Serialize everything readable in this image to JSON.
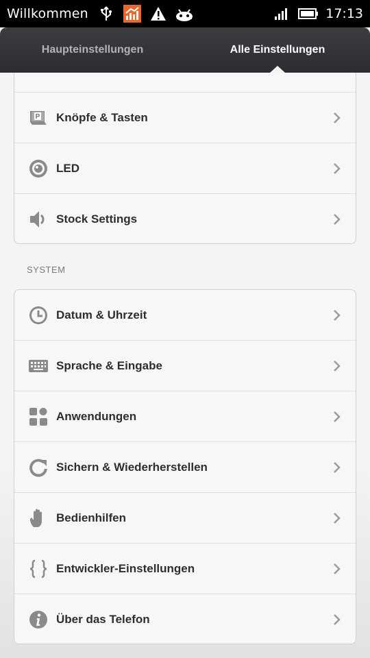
{
  "status_bar": {
    "title": "Willkommen",
    "time": "17:13",
    "icons_left": [
      "usb-icon",
      "chart-notification-icon",
      "warning-icon",
      "android-icon"
    ],
    "icons_right": [
      "signal-icon",
      "battery-icon"
    ],
    "accent_color": "#e8672a"
  },
  "tabs": [
    {
      "label": "Haupteinstellungen",
      "active": false
    },
    {
      "label": "Alle Einstellungen",
      "active": true
    }
  ],
  "group1": {
    "items": [
      {
        "label": "",
        "icon": "partial-icon"
      },
      {
        "label": "Knöpfe & Tasten",
        "icon": "buttons-icon"
      },
      {
        "label": "LED",
        "icon": "led-icon"
      },
      {
        "label": "Stock Settings",
        "icon": "speaker-icon"
      }
    ]
  },
  "system": {
    "header": "SYSTEM",
    "items": [
      {
        "label": "Datum & Uhrzeit",
        "icon": "clock-icon"
      },
      {
        "label": "Sprache & Eingabe",
        "icon": "keyboard-icon"
      },
      {
        "label": "Anwendungen",
        "icon": "apps-icon"
      },
      {
        "label": "Sichern & Wiederherstellen",
        "icon": "backup-icon"
      },
      {
        "label": "Bedienhilfen",
        "icon": "hand-icon"
      },
      {
        "label": "Entwickler-Einstellungen",
        "icon": "braces-icon"
      },
      {
        "label": "Über das Telefon",
        "icon": "info-icon"
      }
    ]
  }
}
